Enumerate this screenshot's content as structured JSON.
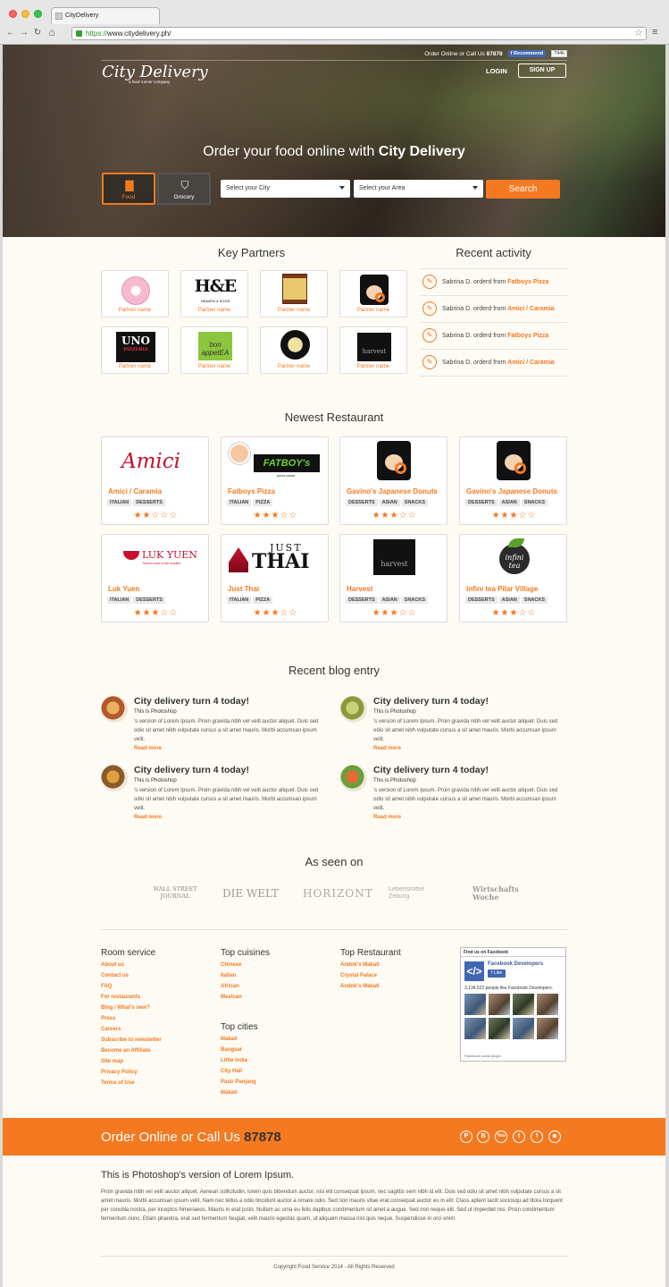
{
  "browser": {
    "tab_title": "CityDelivery",
    "url_prefix": "https://",
    "url_rest": "www.citydelivery.ph/"
  },
  "hero": {
    "topbar_text": "Order Online or Call Us",
    "topbar_phone": "87878",
    "fb_recommend": "Recommend",
    "fb_count": "744k",
    "logo_text": "City Delivery",
    "logo_tagline": "a food runner company",
    "login": "LOGIN",
    "signup": "SIGN UP",
    "headline_prefix": "Order your food online with ",
    "headline_brand": "City Delivery",
    "categories": [
      {
        "label": "Food",
        "icon": "food-bag-icon"
      },
      {
        "label": "Grocery",
        "icon": "grocery-basket-icon"
      }
    ],
    "city_select": "Select your City",
    "area_select": "Select your Area",
    "search": "Search"
  },
  "partners": {
    "title": "Key Partners",
    "items": [
      "Partner name",
      "Partner name",
      "Partner name",
      "Partner name",
      "Partner name",
      "Partner name",
      "Partner name",
      "Partner name"
    ],
    "logos": [
      "pink-circle-logo",
      "H&E",
      "gavinos-sign-logo",
      "gavinos-face-logo",
      "UNO",
      "bon appetEA",
      "ramen-circle-logo",
      "harvest"
    ],
    "he_sub": "HEAVEN & EGGS",
    "uno_sub": "PIZZERIA"
  },
  "activity": {
    "title": "Recent activity",
    "items": [
      {
        "text": "Sabrina D. orderd from ",
        "place": "Fatboys Pizza"
      },
      {
        "text": "Sabrina D. orderd from ",
        "place": "Amici / Caramia"
      },
      {
        "text": "Sabrina D. orderd from ",
        "place": "Fatboys Pizza"
      },
      {
        "text": "Sabrina D. orderd from ",
        "place": "Amici / Caramia"
      }
    ]
  },
  "newest": {
    "title": "Newest Restaurant",
    "items": [
      {
        "name": "Amici / Caramia",
        "tags": [
          "ITALIAN",
          "DESSERTS"
        ],
        "rating": 2,
        "logo": "Amici"
      },
      {
        "name": "Fatboys Pizza",
        "tags": [
          "ITALIAN",
          "PIZZA"
        ],
        "rating": 3,
        "logo": "FATBOY's"
      },
      {
        "name": "Gavino's Japanese Donuts",
        "tags": [
          "DESSERTS",
          "ASIAN",
          "SNACKS"
        ],
        "rating": 3,
        "logo": "gavinos"
      },
      {
        "name": "Gavino's Japanese Donuts",
        "tags": [
          "DESSERTS",
          "ASIAN",
          "SNACKS"
        ],
        "rating": 3,
        "logo": "gavinos"
      },
      {
        "name": "Luk Yuen",
        "tags": [
          "ITALIAN",
          "DESSERTS"
        ],
        "rating": 3,
        "logo": "LUK YUEN"
      },
      {
        "name": "Just Thai",
        "tags": [
          "ITALIAN",
          "PIZZA"
        ],
        "rating": 3,
        "logo": "JUST THAI"
      },
      {
        "name": "Harvest",
        "tags": [
          "DESSERTS",
          "ASIAN",
          "SNACKS"
        ],
        "rating": 3,
        "logo": "harvest"
      },
      {
        "name": "Infini tea Pilar Village",
        "tags": [
          "DESSERTS",
          "ASIAN",
          "SNACKS"
        ],
        "rating": 3,
        "logo": "infini tea"
      }
    ],
    "fatboy_sub": "pizza pasta",
    "lukyuen_sub": "There's more to fall noodles",
    "just": "JUST",
    "thai": "THAI"
  },
  "blog": {
    "title": "Recent blog entry",
    "items": [
      {
        "title": "City delivery turn 4 today!",
        "sub": "This is Photoshop",
        "body": "'s version  of Lorem Ipsum. Proin gravida nibh vel velit auctor aliquet. Duis sed odio sit amet nibh vulputate cursus a sit amet mauris. Morbi accumsan ipsum velit.",
        "more": "Read more"
      },
      {
        "title": "City delivery turn 4 today!",
        "sub": "This is Photoshop",
        "body": "'s version  of Lorem Ipsum. Proin gravida nibh vel velit auctor aliquet. Duis sed odio sit amet nibh vulputate cursus a sit amet mauris. Morbi accumsan ipsum velit.",
        "more": "Read more"
      },
      {
        "title": "City delivery turn 4 today!",
        "sub": "This is Photoshop",
        "body": "'s version  of Lorem Ipsum. Proin gravida nibh vel velit auctor aliquet. Duis sed odio sit amet nibh vulputate cursus a sit amet mauris. Morbi accumsan ipsum velit.",
        "more": "Read more"
      },
      {
        "title": "City delivery turn 4 today!",
        "sub": "This is Photoshop",
        "body": "'s version  of Lorem Ipsum. Proin gravida nibh vel velit auctor aliquet. Duis sed odio sit amet nibh vulputate cursus a sit amet mauris. Morbi accumsan ipsum velit.",
        "more": "Read more"
      }
    ]
  },
  "seen_on": {
    "title": "As seen on",
    "items": [
      "WALL STREET JOURNAL",
      "DIE WELT",
      "HORIZONT",
      "Lebensmittel Zeitung",
      "Wirtschafts Woche"
    ]
  },
  "footer": {
    "room_service": {
      "title": "Room service",
      "links": [
        "About us",
        "Contact us",
        "FAQ",
        "For restaurants",
        "Blog / What's new?",
        "Press",
        "Careers",
        "Subscribe to newsletter",
        "Become an Affiliate",
        "Site map",
        "Privacy Policy",
        "Terms of Use"
      ]
    },
    "top_cuisines": {
      "title": "Top cuisines",
      "links": [
        "Chinese",
        "Italian",
        "African",
        "Mexican"
      ]
    },
    "top_cities": {
      "title": "Top cities",
      "links": [
        "Makati",
        "Bangsar",
        "Little india",
        "City Hall",
        "Pasir Panjang",
        "Makati"
      ]
    },
    "top_restaurant": {
      "title": "Top Restaurant",
      "links": [
        "Andok's Makati",
        "Crystal Palace",
        "Andok's Makati"
      ]
    },
    "facebook": {
      "header": "Find us on Facebook",
      "page": "Facebook Developers",
      "like": "Like",
      "people": "3,134,522 people like Facebook Developers.",
      "plugin": "Facebook social plugin"
    }
  },
  "cta": {
    "text": "Order Online or Call Us ",
    "phone": "87878",
    "social": [
      "pinterest-icon",
      "blogger-icon",
      "youtube-icon",
      "twitter-icon",
      "facebook-icon",
      "instagram-icon"
    ]
  },
  "about": {
    "title": "This is Photoshop's version  of Lorem Ipsum.",
    "body": "Proin gravida nibh vel velit auctor aliquet. Aenean sollicitudin, lorem quis bibendum auctor, nisi elit consequat ipsum, nec sagittis sem nibh id elit. Duis sed odio sit amet nibh vulputate cursus a sit amet mauris. Morbi accumsan ipsum velit. Nam nec tellus a odio tincidunt auctor a ornare odio. Sed non mauris vitae erat consequat auctor eu in elit. Class aptent taciti sociosqu ad litora torquent per conubia nostra, per inceptos himenaeos. Mauris in erat justo. Nullam ac urna eu felis dapibus condimentum sit amet a augue. Sed non neque elit. Sed ut imperdiet nisi. Proin condimentum fermentum nunc. Etiam pharetra, erat sed fermentum feugiat, velit mauris egestas quam, ut aliquam massa nisl quis neque. Suspendisse in orci enim."
  },
  "copyright": "Copyright Food Service 2014 - All Rights Reserved",
  "colors": {
    "accent": "#f47920",
    "background": "#fdfbf4",
    "facebook": "#4267b2"
  }
}
